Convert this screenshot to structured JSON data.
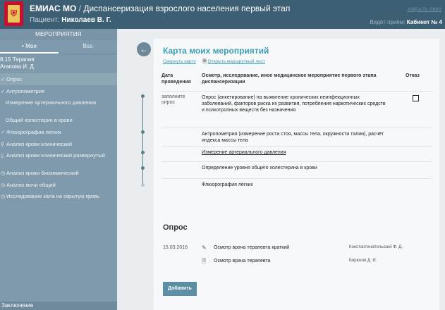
{
  "header": {
    "app_name": "ЕМИАС МО",
    "separator": " / ",
    "section": "Диспансеризация взрослого населения первый этап",
    "patient_label": "Пациент: ",
    "patient_name": "Николаев В. Г.",
    "close_link": "закрыть окно",
    "room_label": "Ведёт приём: ",
    "room_value": "Кабинет № 4"
  },
  "sidebar": {
    "heading": "МЕРОПРИЯТИЯ",
    "tabs": [
      "• Мои",
      "Все"
    ],
    "visit_time": "8:15 Терапия",
    "visit_doctor": "Агапова И. Д.",
    "items": [
      {
        "mark": "✓",
        "label": "Опрос"
      },
      {
        "mark": "✓",
        "label": "Антропометрия"
      },
      {
        "mark": "",
        "label": "Измерение артериального давления"
      },
      {
        "mark": "",
        "label": "Общий холестерин в крови"
      },
      {
        "mark": "✓",
        "label": "Флюорография легких"
      },
      {
        "mark": "⚲",
        "label": "Анализ крови клинический"
      },
      {
        "mark": "▯",
        "label": "Анализ крови клинический развернутый"
      },
      {
        "mark": "◷",
        "label": "Анализ крови биохимический"
      },
      {
        "mark": "◷",
        "label": "Анализ мочи общий"
      },
      {
        "mark": "◷",
        "label": "Исследование кала на скрытую кровь"
      }
    ],
    "footer": "Заключение"
  },
  "card": {
    "title": "Карта моих мероприятий",
    "collapse_link": "Свернуть карту",
    "route_icon": "document-icon",
    "route_link": "Открыть маршрутный лист",
    "columns": {
      "date": "Дата проведения",
      "event": "Осмотр, исследование, иное медицинское мероприятие первого этапа диспансеризации",
      "refusal": "Отказ"
    },
    "rows": [
      {
        "date": "заполните опрос",
        "text": "Опрос (анкетирование) на выявление хронических неинфекционных заболеваний, факторов риска их развития, потребления наркотических средств и психотропных веществ без назначения",
        "refusal": false
      },
      {
        "date": "",
        "text": "Антропометрия (измерение роста стоя, массы тела, окружности талии), расчёт индекса массы тела"
      },
      {
        "date": "",
        "text": "Измерение артериального давления"
      },
      {
        "date": "",
        "text": "Определение уровня общего холестерина в крови"
      },
      {
        "date": "",
        "text": "Флюорография лёгких"
      }
    ]
  },
  "survey": {
    "title": "Опрос",
    "visits": [
      {
        "date": "15.03.2016",
        "icon": "pencil-icon",
        "name": "Осмотр врача терапевта краткий",
        "doctor": "Константинопольский Ф. Д."
      },
      {
        "date": "",
        "icon": "document-icon",
        "name": "Осмотр врача терапевта",
        "doctor": "Бирюков Д. И."
      }
    ],
    "add_button": "Добавить"
  }
}
